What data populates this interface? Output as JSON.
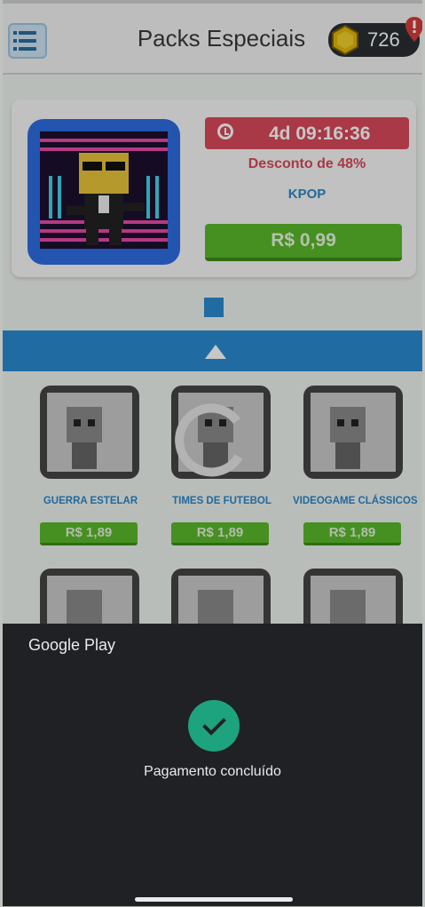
{
  "header": {
    "title": "Packs Especiais",
    "coins": "726",
    "menu_icon": "menu-icon",
    "coin_icon": "coin-icon",
    "location_icon": "location-pin-icon"
  },
  "featured": {
    "timer": "4d 09:16:36",
    "discount": "Desconto de 48%",
    "name": "KPOP",
    "price": "R$ 0,99"
  },
  "grid": {
    "items": [
      {
        "name": "GUERRA ESTELAR",
        "price": "R$ 1,89"
      },
      {
        "name": "TIMES DE FUTEBOL",
        "price": "R$ 1,89"
      },
      {
        "name": "VIDEOGAME CLÁSSICOS",
        "price": "R$ 1,89"
      },
      {
        "name": "",
        "price": ""
      },
      {
        "name": "",
        "price": ""
      },
      {
        "name": "",
        "price": ""
      }
    ]
  },
  "google_play": {
    "brand": "Google Play",
    "status": "Pagamento concluído",
    "accent": "#1ea37f"
  },
  "colors": {
    "accent_blue": "#2a8bd0",
    "price_green": "#59b92a",
    "timer_red": "#d94a5a"
  }
}
